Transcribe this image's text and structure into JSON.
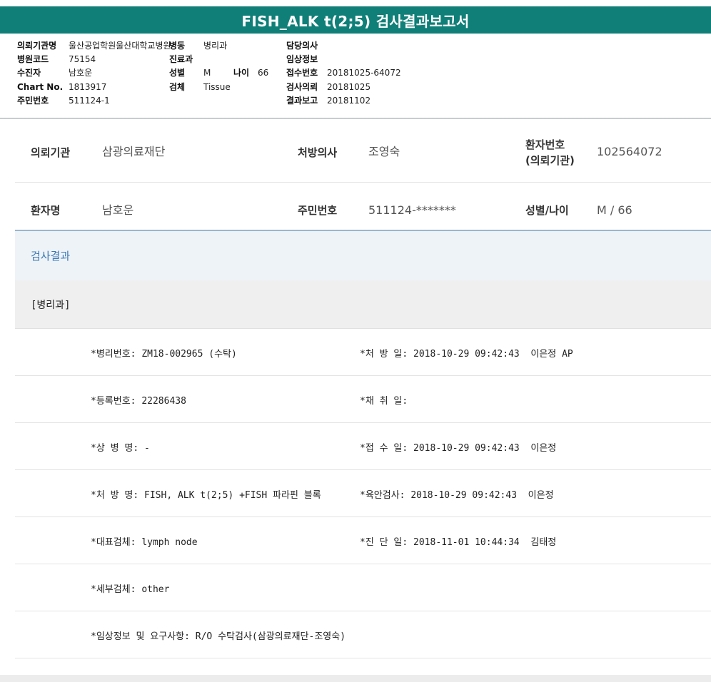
{
  "report": {
    "title": "FISH_ALK t(2;5) 검사결과보고서",
    "header": {
      "col1": [
        {
          "label": "의뢰기관명",
          "value": "울산공업학원울산대학교병원"
        },
        {
          "label": "병원코드",
          "value": "75154"
        },
        {
          "label": "수진자",
          "value": "남호운"
        },
        {
          "label": "Chart No.",
          "value": "1813917"
        },
        {
          "label": "주민번호",
          "value": "511124-1"
        }
      ],
      "col2": [
        {
          "label": "병동",
          "value": "병리과"
        },
        {
          "label": "진료과",
          "value": ""
        },
        {
          "label": "성별",
          "value": "M"
        },
        {
          "label": "검체",
          "value": "Tissue"
        }
      ],
      "age_label": "나이",
      "age_value": "66",
      "col3": [
        {
          "label": "담당의사",
          "value": ""
        },
        {
          "label": "임상정보",
          "value": ""
        },
        {
          "label": "접수번호",
          "value": "20181025-64072"
        },
        {
          "label": "검사의뢰",
          "value": "20181025"
        },
        {
          "label": "결과보고",
          "value": "20181102"
        }
      ]
    }
  },
  "info": {
    "row1": {
      "l1": "의뢰기관",
      "v1": "삼광의료재단",
      "l2": "처방의사",
      "v2": "조영숙",
      "l3a": "환자번호",
      "l3b": "(의뢰기관)",
      "v3": "102564072"
    },
    "row2": {
      "l1": "환자명",
      "v1": "남호운",
      "l2": "주민번호",
      "v2": "511124-*******",
      "l3": "성별/나이",
      "v3": "M / 66"
    }
  },
  "results": {
    "section_title": "검사결과",
    "pathology_title": "[병리과]",
    "rows": [
      {
        "left": "*병리번호: ZM18-002965 (수탁)",
        "right": "*처 방 일: 2018-10-29 09:42:43  이은정 AP"
      },
      {
        "left": "*등록번호: 22286438",
        "right": "*채 취 일:"
      },
      {
        "left": "*상 병 명: -",
        "right": "*접 수 일: 2018-10-29 09:42:43  이은정"
      },
      {
        "left": "*처 방 명: FISH, ALK t(2;5) +FISH 파라핀 블록",
        "right": "*육안검사: 2018-10-29 09:42:43  이은정"
      },
      {
        "left": "*대표검체: lymph node",
        "right": "*진 단 일: 2018-11-01 10:44:34  김태정"
      },
      {
        "left": "*세부검체: other",
        "right": ""
      },
      {
        "left": "*임상정보 및 요구사항: R/O 수탁검사(삼광의료재단-조영숙)",
        "right": ""
      }
    ]
  }
}
